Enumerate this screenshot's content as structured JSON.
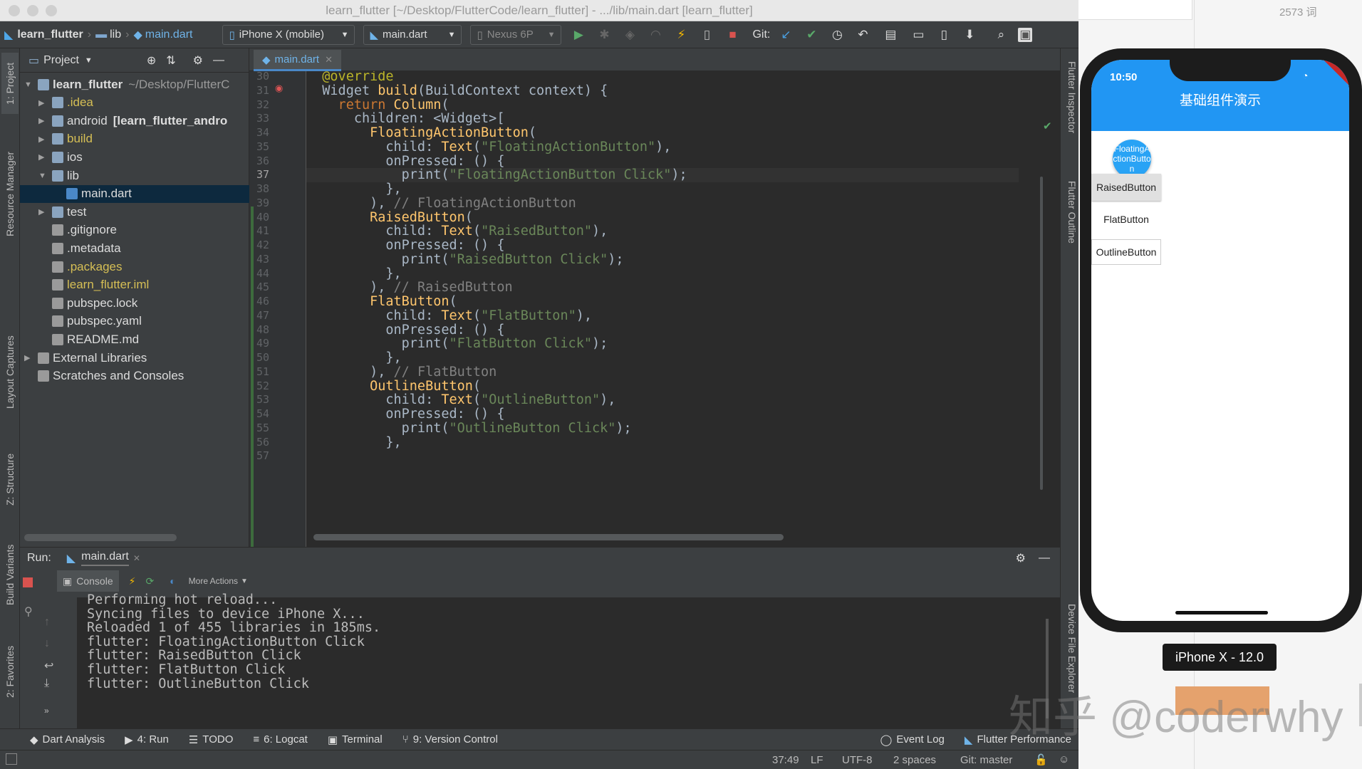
{
  "window": {
    "title": "learn_flutter [~/Desktop/FlutterCode/learn_flutter] - .../lib/main.dart [learn_flutter]"
  },
  "side_counter": "2573 词",
  "breadcrumb": [
    "learn_flutter",
    "lib",
    "main.dart"
  ],
  "toolbar": {
    "device_selector": "iPhone X (mobile)",
    "run_config": "main.dart",
    "avd": "Nexus 6P",
    "git_label": "Git:"
  },
  "left_tabs": [
    "1: Project",
    "Resource Manager",
    "Layout Captures",
    "Z: Structure",
    "Build Variants",
    "2: Favorites"
  ],
  "right_tabs": [
    "Flutter Inspector",
    "Flutter Outline",
    "Device File Explorer"
  ],
  "project": {
    "header": "Project",
    "tree": [
      {
        "label": "learn_flutter",
        "suffix": "~/Desktop/FlutterC",
        "depth": 0,
        "expanded": "open",
        "bold": "yes",
        "color": "#dcdcdc",
        "icon": "folder-icon"
      },
      {
        "label": ".idea",
        "suffix": "",
        "depth": 1,
        "expanded": "closed",
        "bold": "no",
        "color": "#d6bf55",
        "icon": "folder-icon"
      },
      {
        "label": "android",
        "suffix": "[learn_flutter_andro",
        "depth": 1,
        "expanded": "closed",
        "bold": "no",
        "color": "#dcdcdc",
        "icon": "folder-icon"
      },
      {
        "label": "build",
        "suffix": "",
        "depth": 1,
        "expanded": "closed",
        "bold": "no",
        "color": "#d6bf55",
        "icon": "folder-icon"
      },
      {
        "label": "ios",
        "suffix": "",
        "depth": 1,
        "expanded": "closed",
        "bold": "no",
        "color": "#dcdcdc",
        "icon": "folder-icon"
      },
      {
        "label": "lib",
        "suffix": "",
        "depth": 1,
        "expanded": "open",
        "bold": "no",
        "color": "#dcdcdc",
        "icon": "folder-icon"
      },
      {
        "label": "main.dart",
        "suffix": "",
        "depth": 2,
        "expanded": "none",
        "bold": "no",
        "color": "#dcdcdc",
        "icon": "dart-file-icon"
      },
      {
        "label": "test",
        "suffix": "",
        "depth": 1,
        "expanded": "closed",
        "bold": "no",
        "color": "#dcdcdc",
        "icon": "folder-icon"
      },
      {
        "label": ".gitignore",
        "suffix": "",
        "depth": 1,
        "expanded": "none",
        "bold": "no",
        "color": "#dcdcdc",
        "icon": "file-icon"
      },
      {
        "label": ".metadata",
        "suffix": "",
        "depth": 1,
        "expanded": "none",
        "bold": "no",
        "color": "#dcdcdc",
        "icon": "file-icon"
      },
      {
        "label": ".packages",
        "suffix": "",
        "depth": 1,
        "expanded": "none",
        "bold": "no",
        "color": "#d6bf55",
        "icon": "file-icon"
      },
      {
        "label": "learn_flutter.iml",
        "suffix": "",
        "depth": 1,
        "expanded": "none",
        "bold": "no",
        "color": "#d6bf55",
        "icon": "iml-file-icon"
      },
      {
        "label": "pubspec.lock",
        "suffix": "",
        "depth": 1,
        "expanded": "none",
        "bold": "no",
        "color": "#dcdcdc",
        "icon": "file-icon"
      },
      {
        "label": "pubspec.yaml",
        "suffix": "",
        "depth": 1,
        "expanded": "none",
        "bold": "no",
        "color": "#dcdcdc",
        "icon": "yaml-file-icon"
      },
      {
        "label": "README.md",
        "suffix": "",
        "depth": 1,
        "expanded": "none",
        "bold": "no",
        "color": "#dcdcdc",
        "icon": "file-icon"
      },
      {
        "label": "External Libraries",
        "suffix": "",
        "depth": 0,
        "expanded": "closed",
        "bold": "no",
        "color": "#dcdcdc",
        "icon": "library-icon"
      },
      {
        "label": "Scratches and Consoles",
        "suffix": "",
        "depth": 0,
        "expanded": "none",
        "bold": "no",
        "color": "#dcdcdc",
        "icon": "scratches-icon"
      }
    ],
    "selected_index": 6
  },
  "editor": {
    "tab": "main.dart",
    "current_line": 37,
    "lines": [
      {
        "n": 30,
        "t": [
          [
            "ann",
            "  @override"
          ]
        ]
      },
      {
        "n": 31,
        "t": [
          [
            "pl",
            "  Widget "
          ],
          [
            "fn",
            "build"
          ],
          [
            "pl",
            "(BuildContext context) "
          ],
          [
            "br",
            "{"
          ]
        ]
      },
      {
        "n": 32,
        "t": [
          [
            "kw",
            "    return "
          ],
          [
            "fn",
            "Column"
          ],
          [
            "br",
            "("
          ]
        ]
      },
      {
        "n": 33,
        "t": [
          [
            "pl",
            "      children: "
          ],
          [
            "br",
            "<Widget>["
          ]
        ]
      },
      {
        "n": 34,
        "t": [
          [
            "pl",
            "        "
          ],
          [
            "fn",
            "FloatingActionButton"
          ],
          [
            "br",
            "("
          ]
        ]
      },
      {
        "n": 35,
        "t": [
          [
            "pl",
            "          child: "
          ],
          [
            "fn",
            "Text"
          ],
          [
            "br",
            "("
          ],
          [
            "str",
            "\"FloatingActionButton\""
          ],
          [
            "br",
            ")"
          ],
          [
            "pl",
            ","
          ]
        ]
      },
      {
        "n": 36,
        "t": [
          [
            "pl",
            "          onPressed: "
          ],
          [
            "br",
            "() {"
          ]
        ]
      },
      {
        "n": 37,
        "t": [
          [
            "pl",
            "            print("
          ],
          [
            "str",
            "\"FloatingActionButton Click\""
          ],
          [
            "pl",
            ");"
          ]
        ]
      },
      {
        "n": 38,
        "t": [
          [
            "br",
            "          },"
          ]
        ]
      },
      {
        "n": 39,
        "t": [
          [
            "br",
            "        ), "
          ],
          [
            "cm",
            "// FloatingActionButton"
          ]
        ]
      },
      {
        "n": 40,
        "t": [
          [
            "pl",
            "        "
          ],
          [
            "fn",
            "RaisedButton"
          ],
          [
            "br",
            "("
          ]
        ]
      },
      {
        "n": 41,
        "t": [
          [
            "pl",
            "          child: "
          ],
          [
            "fn",
            "Text"
          ],
          [
            "br",
            "("
          ],
          [
            "str",
            "\"RaisedButton\""
          ],
          [
            "br",
            ")"
          ],
          [
            "pl",
            ","
          ]
        ]
      },
      {
        "n": 42,
        "t": [
          [
            "pl",
            "          onPressed: "
          ],
          [
            "br",
            "() {"
          ]
        ]
      },
      {
        "n": 43,
        "t": [
          [
            "pl",
            "            print("
          ],
          [
            "str",
            "\"RaisedButton Click\""
          ],
          [
            "pl",
            ");"
          ]
        ]
      },
      {
        "n": 44,
        "t": [
          [
            "br",
            "          },"
          ]
        ]
      },
      {
        "n": 45,
        "t": [
          [
            "br",
            "        ), "
          ],
          [
            "cm",
            "// RaisedButton"
          ]
        ]
      },
      {
        "n": 46,
        "t": [
          [
            "pl",
            "        "
          ],
          [
            "fn",
            "FlatButton"
          ],
          [
            "br",
            "("
          ]
        ]
      },
      {
        "n": 47,
        "t": [
          [
            "pl",
            "          child: "
          ],
          [
            "fn",
            "Text"
          ],
          [
            "br",
            "("
          ],
          [
            "str",
            "\"FlatButton\""
          ],
          [
            "br",
            ")"
          ],
          [
            "pl",
            ","
          ]
        ]
      },
      {
        "n": 48,
        "t": [
          [
            "pl",
            "          onPressed: "
          ],
          [
            "br",
            "() {"
          ]
        ]
      },
      {
        "n": 49,
        "t": [
          [
            "pl",
            "            print("
          ],
          [
            "str",
            "\"FlatButton Click\""
          ],
          [
            "pl",
            ");"
          ]
        ]
      },
      {
        "n": 50,
        "t": [
          [
            "br",
            "          },"
          ]
        ]
      },
      {
        "n": 51,
        "t": [
          [
            "br",
            "        ), "
          ],
          [
            "cm",
            "// FlatButton"
          ]
        ]
      },
      {
        "n": 52,
        "t": [
          [
            "pl",
            "        "
          ],
          [
            "fn",
            "OutlineButton"
          ],
          [
            "br",
            "("
          ]
        ]
      },
      {
        "n": 53,
        "t": [
          [
            "pl",
            "          child: "
          ],
          [
            "fn",
            "Text"
          ],
          [
            "br",
            "("
          ],
          [
            "str",
            "\"OutlineButton\""
          ],
          [
            "br",
            ")"
          ],
          [
            "pl",
            ","
          ]
        ]
      },
      {
        "n": 54,
        "t": [
          [
            "pl",
            "          onPressed: "
          ],
          [
            "br",
            "() {"
          ]
        ]
      },
      {
        "n": 55,
        "t": [
          [
            "pl",
            "            print("
          ],
          [
            "str",
            "\"OutlineButton Click\""
          ],
          [
            "pl",
            ");"
          ]
        ]
      },
      {
        "n": 56,
        "t": [
          [
            "br",
            "          },"
          ]
        ]
      },
      {
        "n": 57,
        "t": [
          [
            "pl",
            ""
          ]
        ]
      }
    ]
  },
  "run": {
    "label": "Run:",
    "tab": "main.dart",
    "console_tab": "Console",
    "more_actions": "More Actions",
    "output": [
      "Performing hot reload...",
      "Syncing files to device iPhone X...",
      "Reloaded 1 of 455 libraries in 185ms.",
      "flutter: FloatingActionButton Click",
      "flutter: RaisedButton Click",
      "flutter: FlatButton Click",
      "flutter: OutlineButton Click"
    ]
  },
  "bottom_tools": {
    "left": [
      "Dart Analysis",
      "4: Run",
      "TODO",
      "6: Logcat",
      "Terminal",
      "9: Version Control"
    ],
    "right": [
      "Event Log",
      "Flutter Performance"
    ]
  },
  "status": {
    "position": "37:49",
    "line_sep": "LF",
    "encoding": "UTF-8",
    "indent": "2 spaces",
    "git": "Git: master"
  },
  "simulator": {
    "time": "10:50",
    "debug_banner": "DEBUG",
    "app_title": "基础组件演示",
    "fab_label": "FloatingActionButton",
    "raised": "RaisedButton",
    "flat": "FlatButton",
    "outline": "OutlineButton",
    "device_label": "iPhone X - 12.0"
  },
  "watermark": "知乎 @coderwhy",
  "colors": {
    "keyword": "#cc7832",
    "function": "#ffc66d",
    "string": "#6a8759",
    "comment": "#808080",
    "annotation": "#bbb529",
    "bracket": "#a9b7c6",
    "plain": "#a9b7c6",
    "accent": "#2196f3"
  }
}
